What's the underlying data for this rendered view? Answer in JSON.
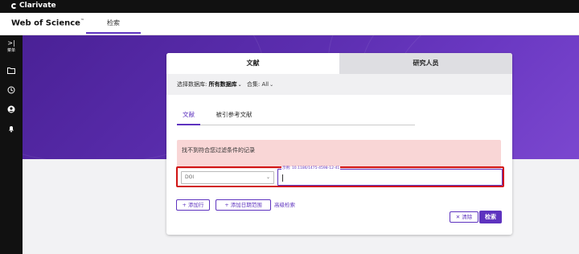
{
  "topbar": {
    "brand": "Clarivate"
  },
  "header": {
    "product": "Web of Science",
    "product_tm": "™",
    "nav_tab": "检索"
  },
  "rail": {
    "expand_glyph": ">|",
    "menu_label": "菜单"
  },
  "card": {
    "tabs": [
      {
        "label": "文献"
      },
      {
        "label": "研究人员"
      }
    ],
    "db_label": "选择数据库:",
    "db_value": "所有数据库",
    "collection_label": "合集:",
    "collection_value": "All",
    "subtabs": [
      {
        "label": "文献"
      },
      {
        "label": "被引参考文献"
      }
    ],
    "alert_text": "找不到符合您过滤条件的记录",
    "field_select": "DOI",
    "input_label": "示例: 10.1186/1475-4598-12-41",
    "input_value": "",
    "add_row": "+ 添加行",
    "add_date": "+ 添加日期范围",
    "advanced": "高级检索",
    "clear": "✕ 清除",
    "search": "检索"
  },
  "colors": {
    "accent": "#5e33bf",
    "error_border": "#d01414",
    "alert_bg": "#f9d6d6",
    "hero": "#5c2eb0"
  }
}
